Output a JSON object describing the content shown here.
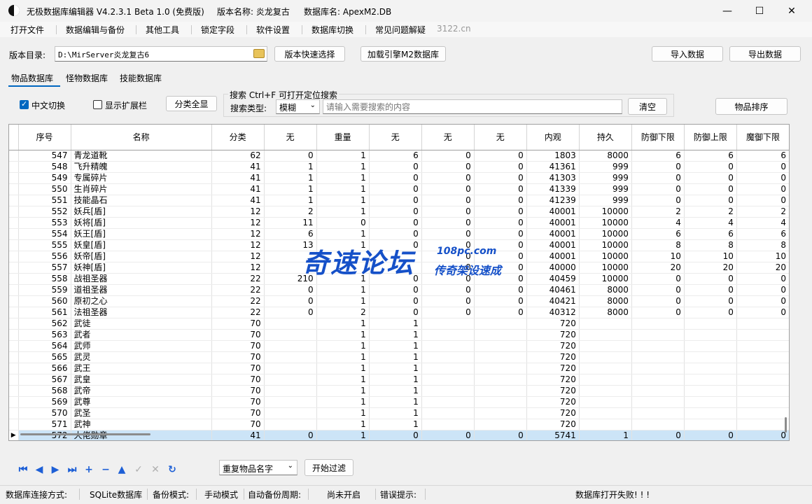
{
  "titlebar": {
    "app_title": "无极数据库编辑器 V4.2.3.1",
    "beta": "Beta 1.0 (免费版)",
    "version_name": "版本名称: 炎龙复古",
    "db_name": "数据库名: ApexM2.DB",
    "minimize": "—",
    "maximize": "☐",
    "close": "✕"
  },
  "menu": {
    "items": [
      "打开文件",
      "数据编辑与备份",
      "其他工具",
      "锁定字段",
      "软件设置",
      "数据库切换",
      "常见问题解疑"
    ],
    "site": "3122.cn"
  },
  "toolbar": {
    "dir_label": "版本目录:",
    "dir_value": "D:\\MirServer炎龙复古6",
    "quick_select": "版本快速选择",
    "load_engine": "加载引擎M2数据库",
    "import": "导入数据",
    "export": "导出数据"
  },
  "tabs": [
    "物品数据库",
    "怪物数据库",
    "技能数据库"
  ],
  "options": {
    "chinese_toggle": "中文切换",
    "show_ext": "显示扩展栏",
    "show_all": "分类全显",
    "search_title": "搜索  Ctrl+F 可打开定位搜索",
    "search_type_label": "搜索类型:",
    "search_type_value": "模糊",
    "search_placeholder": "请输入需要搜索的内容",
    "clear": "清空",
    "sort_items": "物品排序"
  },
  "grid": {
    "columns": [
      "序号",
      "名称",
      "分类",
      "无",
      "重量",
      "无",
      "无",
      "无",
      "内观",
      "持久",
      "防御下限",
      "防御上限",
      "魔御下限"
    ],
    "rows": [
      [
        "547",
        "青龙道靴",
        "62",
        "0",
        "1",
        "6",
        "0",
        "0",
        "1803",
        "8000",
        "6",
        "6",
        "6"
      ],
      [
        "548",
        "飞升精魄",
        "41",
        "1",
        "1",
        "0",
        "0",
        "0",
        "41361",
        "999",
        "0",
        "0",
        "0"
      ],
      [
        "549",
        "专属碎片",
        "41",
        "1",
        "1",
        "0",
        "0",
        "0",
        "41303",
        "999",
        "0",
        "0",
        "0"
      ],
      [
        "550",
        "生肖碎片",
        "41",
        "1",
        "1",
        "0",
        "0",
        "0",
        "41339",
        "999",
        "0",
        "0",
        "0"
      ],
      [
        "551",
        "技能晶石",
        "41",
        "1",
        "1",
        "0",
        "0",
        "0",
        "41239",
        "999",
        "0",
        "0",
        "0"
      ],
      [
        "552",
        "妖兵[盾]",
        "12",
        "2",
        "1",
        "0",
        "0",
        "0",
        "40001",
        "10000",
        "2",
        "2",
        "2"
      ],
      [
        "553",
        "妖将[盾]",
        "12",
        "11",
        "0",
        "0",
        "0",
        "0",
        "40001",
        "10000",
        "4",
        "4",
        "4"
      ],
      [
        "554",
        "妖王[盾]",
        "12",
        "6",
        "1",
        "0",
        "0",
        "0",
        "40001",
        "10000",
        "6",
        "6",
        "6"
      ],
      [
        "555",
        "妖皇[盾]",
        "12",
        "13",
        "1",
        "0",
        "0",
        "0",
        "40001",
        "10000",
        "8",
        "8",
        "8"
      ],
      [
        "556",
        "妖帝[盾]",
        "12",
        "",
        "",
        "",
        "0",
        "0",
        "40001",
        "10000",
        "10",
        "10",
        "10"
      ],
      [
        "557",
        "妖神[盾]",
        "12",
        "",
        "",
        "",
        "0",
        "0",
        "40000",
        "10000",
        "20",
        "20",
        "20"
      ],
      [
        "558",
        "战祖圣器",
        "22",
        "210",
        "1",
        "0",
        "0",
        "0",
        "40459",
        "10000",
        "0",
        "0",
        "0"
      ],
      [
        "559",
        "道祖圣器",
        "22",
        "0",
        "1",
        "0",
        "0",
        "0",
        "40461",
        "8000",
        "0",
        "0",
        "0"
      ],
      [
        "560",
        "原初之心",
        "22",
        "0",
        "1",
        "0",
        "0",
        "0",
        "40421",
        "8000",
        "0",
        "0",
        "0"
      ],
      [
        "561",
        "法祖圣器",
        "22",
        "0",
        "2",
        "0",
        "0",
        "0",
        "40312",
        "8000",
        "0",
        "0",
        "0"
      ],
      [
        "562",
        "武徒",
        "70",
        "",
        "1",
        "1",
        "",
        "",
        "720",
        "",
        "",
        "",
        ""
      ],
      [
        "563",
        "武者",
        "70",
        "",
        "1",
        "1",
        "",
        "",
        "720",
        "",
        "",
        "",
        ""
      ],
      [
        "564",
        "武师",
        "70",
        "",
        "1",
        "1",
        "",
        "",
        "720",
        "",
        "",
        "",
        ""
      ],
      [
        "565",
        "武灵",
        "70",
        "",
        "1",
        "1",
        "",
        "",
        "720",
        "",
        "",
        "",
        ""
      ],
      [
        "566",
        "武王",
        "70",
        "",
        "1",
        "1",
        "",
        "",
        "720",
        "",
        "",
        "",
        ""
      ],
      [
        "567",
        "武皇",
        "70",
        "",
        "1",
        "1",
        "",
        "",
        "720",
        "",
        "",
        "",
        ""
      ],
      [
        "568",
        "武帝",
        "70",
        "",
        "1",
        "1",
        "",
        "",
        "720",
        "",
        "",
        "",
        ""
      ],
      [
        "569",
        "武尊",
        "70",
        "",
        "1",
        "1",
        "",
        "",
        "720",
        "",
        "",
        "",
        ""
      ],
      [
        "570",
        "武圣",
        "70",
        "",
        "1",
        "1",
        "",
        "",
        "720",
        "",
        "",
        "",
        ""
      ],
      [
        "571",
        "武神",
        "70",
        "",
        "1",
        "1",
        "",
        "",
        "720",
        "",
        "",
        "",
        ""
      ],
      [
        "572",
        "大佬勋章",
        "41",
        "0",
        "1",
        "0",
        "0",
        "0",
        "5741",
        "1",
        "0",
        "0",
        "0"
      ]
    ],
    "selected_index": 25,
    "selected_marker": "▶"
  },
  "nav": {
    "icons": [
      "first-icon",
      "prior-icon",
      "next-icon",
      "last-icon",
      "insert-icon",
      "delete-icon",
      "edit-icon",
      "post-icon",
      "cancel-icon",
      "refresh-icon"
    ],
    "glyphs": [
      "⏮",
      "◀",
      "▶",
      "⏭",
      "+",
      "−",
      "▲",
      "✓",
      "✕",
      "↻"
    ],
    "filter_value": "重复物品名字",
    "filter_button": "开始过滤"
  },
  "watermark": {
    "main": "奇速论坛",
    "domain": "108pc.com",
    "slogan": "传奇架设速成"
  },
  "statusbar": {
    "conn_label": "数据库连接方式:",
    "conn_value": "SQLite数据库",
    "backup_label": "备份模式:",
    "backup_value": "手动模式",
    "auto_label": "自动备份周期:",
    "auto_value": "尚未开启",
    "error_label": "错误提示:",
    "error_value": "数据库打开失败! ! !"
  },
  "colors": {
    "accent": "#0067c0",
    "selected_row": "#cce4f7",
    "nav_icon": "#1d5fd6",
    "watermark": "#1550c8"
  }
}
